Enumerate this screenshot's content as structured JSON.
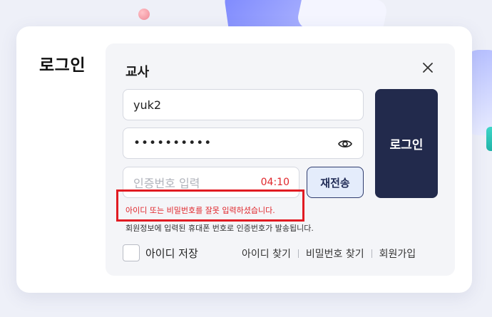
{
  "page": {
    "heading": "로그인"
  },
  "panel": {
    "title": "교사",
    "id_value": "yuk2",
    "password_masked": "••••••••••",
    "code_placeholder": "인증번호 입력",
    "timer": "04:10",
    "resend_label": "재전송",
    "login_label": "로그인",
    "error_message": "아이디 또는 비밀번호를 잘못 입력하셨습니다.",
    "info_message": "회원정보에 입력된 휴대폰 번호로 인증번호가 발송됩니다.",
    "remember_label": "아이디 저장",
    "links": {
      "find_id": "아이디 찾기",
      "find_password": "비밀번호 찾기",
      "signup": "회원가입"
    }
  },
  "icons": {
    "close": "close-icon",
    "show_password": "eye-icon"
  },
  "colors": {
    "login_button": "#222a4c",
    "resend_bg": "#e4ecfb",
    "error": "#e0262b",
    "highlight_box": "#e11b22"
  }
}
